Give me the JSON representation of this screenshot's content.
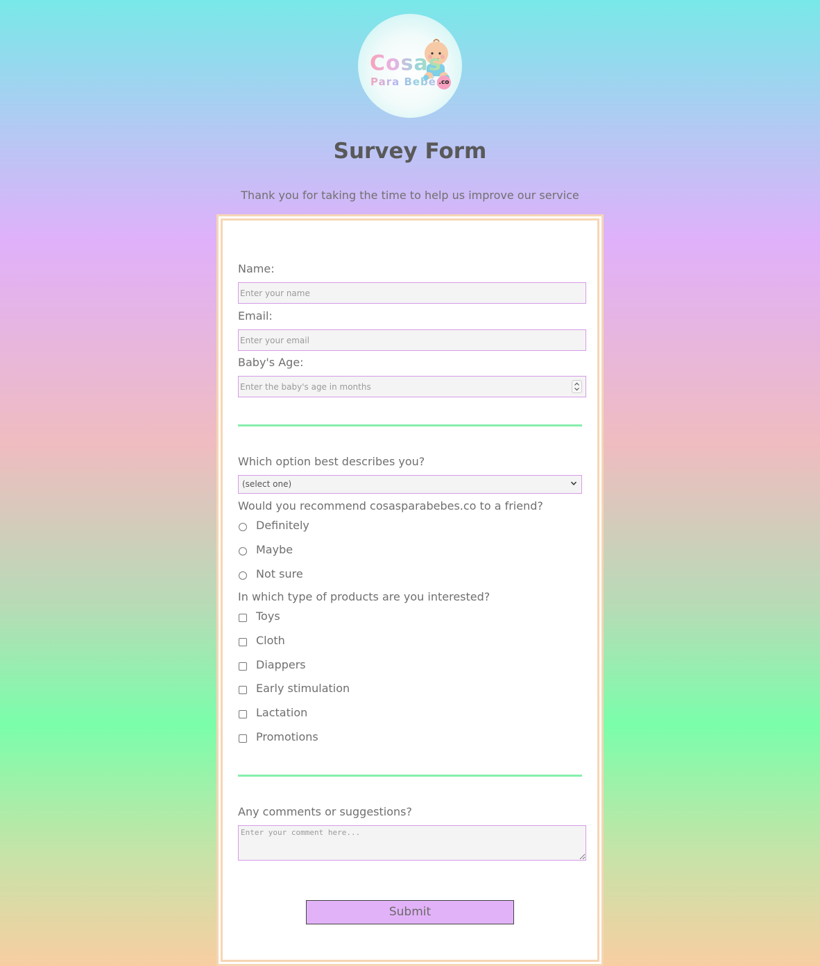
{
  "logo": {
    "line1": "Cosas",
    "line2": "Para Bebés",
    "suffix": ".co",
    "icon": "baby-icon"
  },
  "header": {
    "title": "Survey Form",
    "description": "Thank you for taking the time to help us improve our service"
  },
  "form": {
    "name": {
      "label": "Name:",
      "placeholder": "Enter your name"
    },
    "email": {
      "label": "Email:",
      "placeholder": "Enter your email"
    },
    "age": {
      "label": "Baby's Age:",
      "placeholder": "Enter the baby's age in months"
    },
    "role": {
      "label": "Which option best describes you?",
      "selected": "(select one)"
    },
    "recommend": {
      "label": "Would you recommend cosasparabebes.co to a friend?",
      "options": [
        "Definitely",
        "Maybe",
        "Not sure"
      ]
    },
    "products": {
      "label": "In which type of products are you interested?",
      "options": [
        "Toys",
        "Cloth",
        "Diappers",
        "Early stimulation",
        "Lactation",
        "Promotions"
      ]
    },
    "comments": {
      "label": "Any comments or suggestions?",
      "placeholder": "Enter your comment here..."
    },
    "submit_label": "Submit"
  },
  "colors": {
    "accent": "#e2b2f8",
    "divider": "#86efac",
    "frame": "#f6d6b4",
    "input_border": "#d59be8"
  }
}
